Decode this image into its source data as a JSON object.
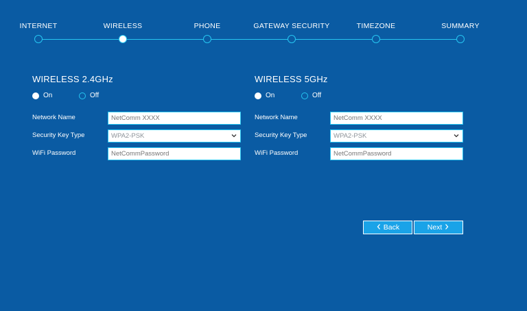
{
  "stepper": {
    "steps": [
      {
        "label": "INTERNET",
        "state": "done"
      },
      {
        "label": "WIRELESS",
        "state": "active"
      },
      {
        "label": "PHONE",
        "state": "pending"
      },
      {
        "label": "GATEWAY SECURITY",
        "state": "pending"
      },
      {
        "label": "TIMEZONE",
        "state": "pending"
      },
      {
        "label": "SUMMARY",
        "state": "pending"
      }
    ]
  },
  "wireless24": {
    "title": "WIRELESS 2.4GHz",
    "radio_on": "On",
    "radio_off": "Off",
    "selected": "On",
    "network_name_label": "Network Name",
    "network_name_placeholder": "NetComm XXXX",
    "security_key_type_label": "Security Key Type",
    "security_key_type_value": "WPA2-PSK",
    "wifi_password_label": "WiFi Password",
    "wifi_password_placeholder": "NetCommPassword"
  },
  "wireless5": {
    "title": "WIRELESS 5GHz",
    "radio_on": "On",
    "radio_off": "Off",
    "selected": "On",
    "network_name_label": "Network Name",
    "network_name_placeholder": "NetComm XXXX",
    "security_key_type_label": "Security Key Type",
    "security_key_type_value": "WPA2-PSK",
    "wifi_password_label": "WiFi Password",
    "wifi_password_placeholder": "NetCommPassword"
  },
  "nav": {
    "back_label": "Back",
    "next_label": "Next"
  },
  "colors": {
    "background": "#0a5ba3",
    "accent": "#26c6f2",
    "button": "#1aa3e8"
  },
  "icons": {
    "back": "chevron-left-icon",
    "next": "chevron-right-icon",
    "select": "chevron-down-icon"
  }
}
